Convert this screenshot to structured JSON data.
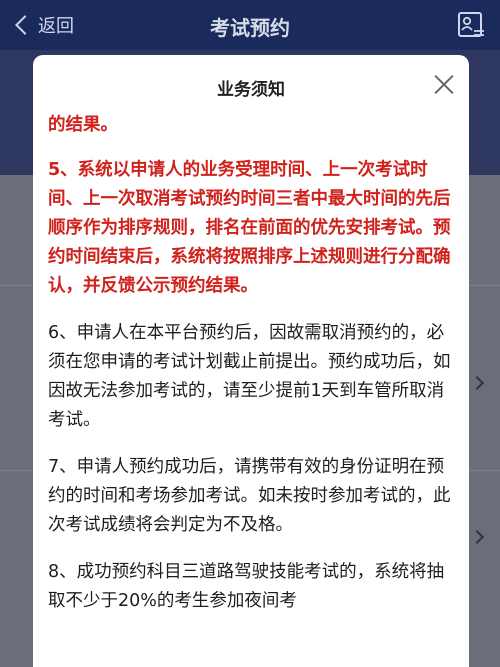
{
  "nav": {
    "back_label": "返回",
    "title": "考试预约",
    "icon": "user-doc-icon"
  },
  "modal": {
    "title": "业务须知",
    "close_icon": "close-icon",
    "paragraphs": [
      {
        "text": "的结果。",
        "highlight": true
      },
      {
        "text": "5、系统以申请人的业务受理时间、上一次考试时间、上一次取消考试预约时间三者中最大时间的先后顺序作为排序规则，排名在前面的优先安排考试。预约时间结束后，系统将按照排序上述规则进行分配确认，并反馈公示预约结果。",
        "highlight": true
      },
      {
        "text": "6、申请人在本平台预约后，因故需取消预约的，必须在您申请的考试计划截止前提出。预约成功后，如因故无法参加考试的，请至少提前1天到车管所取消考试。",
        "highlight": false
      },
      {
        "text": "7、申请人预约成功后，请携带有效的身份证明在预约的时间和考场参加考试。如未按时参加考试的，此次考试成绩将会判定为不及格。",
        "highlight": false
      },
      {
        "text": "8、成功预约科目三道路驾驶技能考试的，系统将抽取不少于20%的考生参加夜间考",
        "highlight": false
      }
    ],
    "highlight_color": "#d0211b"
  }
}
